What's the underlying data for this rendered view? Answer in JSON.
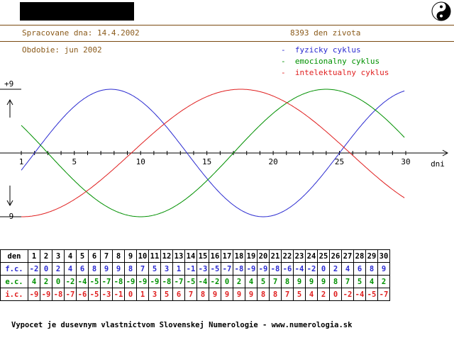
{
  "header": {
    "processed_label": "Spracovane dna: 14.4.2002",
    "days_lived": "8393 den zivota",
    "period_label": "Obdobie: jun 2002"
  },
  "colors": {
    "physical": "#2a2ad0",
    "emotional": "#009000",
    "intellectual": "#e02020",
    "header_text": "#8a5a1a"
  },
  "legend": [
    {
      "label": "-  fyzicky cyklus",
      "color": "#2a2ad0"
    },
    {
      "label": "-  emocionalny cyklus",
      "color": "#009000"
    },
    {
      "label": "-  intelektualny cyklus",
      "color": "#e02020"
    }
  ],
  "chart_data": {
    "type": "line",
    "xlabel": "dni",
    "ylim": [
      -9,
      9
    ],
    "y_ticks": [
      "+9",
      "-9"
    ],
    "x_ticks": [
      "1",
      "5",
      "10",
      "15",
      "20",
      "25",
      "30"
    ],
    "x": [
      1,
      2,
      3,
      4,
      5,
      6,
      7,
      8,
      9,
      10,
      11,
      12,
      13,
      14,
      15,
      16,
      17,
      18,
      19,
      20,
      21,
      22,
      23,
      24,
      25,
      26,
      27,
      28,
      29,
      30
    ],
    "series": [
      {
        "name": "fyzicky cyklus",
        "key": "physical",
        "phase": 23,
        "values": [
          -2,
          0,
          2,
          4,
          6,
          8,
          9,
          9,
          8,
          7,
          5,
          3,
          1,
          -1,
          -3,
          -5,
          -7,
          -8,
          -9,
          -9,
          -8,
          -6,
          -4,
          -2,
          0,
          2,
          4,
          6,
          8,
          9
        ]
      },
      {
        "name": "emocionalny cyklus",
        "key": "emotional",
        "phase": 28,
        "values": [
          4,
          2,
          0,
          -2,
          -4,
          -5,
          -7,
          -8,
          -9,
          -9,
          -9,
          -8,
          -7,
          -5,
          -4,
          -2,
          0,
          2,
          4,
          5,
          7,
          8,
          9,
          9,
          9,
          8,
          7,
          5,
          4,
          2
        ]
      },
      {
        "name": "intelektualny cyklus",
        "key": "intellectual",
        "phase": 33,
        "values": [
          -9,
          -9,
          -8,
          -7,
          -6,
          -5,
          -3,
          -1,
          0,
          1,
          3,
          5,
          6,
          7,
          8,
          9,
          9,
          9,
          9,
          8,
          8,
          7,
          5,
          4,
          2,
          0,
          -2,
          -4,
          -5,
          -7
        ]
      }
    ]
  },
  "table": {
    "rows": [
      {
        "label": "den",
        "values": [
          "1",
          "2",
          "3",
          "4",
          "5",
          "6",
          "7",
          "8",
          "9",
          "10",
          "11",
          "12",
          "13",
          "14",
          "15",
          "16",
          "17",
          "18",
          "19",
          "20",
          "21",
          "22",
          "23",
          "24",
          "25",
          "26",
          "27",
          "28",
          "29",
          "30"
        ]
      },
      {
        "label": "f.c.",
        "values": [
          "-2",
          "0",
          "2",
          "4",
          "6",
          "8",
          "9",
          "9",
          "8",
          "7",
          "5",
          "3",
          "1",
          "-1",
          "-3",
          "-5",
          "-7",
          "-8",
          "-9",
          "-9",
          "-8",
          "-6",
          "-4",
          "-2",
          "0",
          "2",
          "4",
          "6",
          "8",
          "9"
        ]
      },
      {
        "label": "e.c.",
        "values": [
          "4",
          "2",
          "0",
          "-2",
          "-4",
          "-5",
          "-7",
          "-8",
          "-9",
          "-9",
          "-9",
          "-8",
          "-7",
          "-5",
          "-4",
          "-2",
          "0",
          "2",
          "4",
          "5",
          "7",
          "8",
          "9",
          "9",
          "9",
          "8",
          "7",
          "5",
          "4",
          "2"
        ]
      },
      {
        "label": "i.c.",
        "values": [
          "-9",
          "-9",
          "-8",
          "-7",
          "-6",
          "-5",
          "-3",
          "-1",
          "0",
          "1",
          "3",
          "5",
          "6",
          "7",
          "8",
          "9",
          "9",
          "9",
          "9",
          "8",
          "8",
          "7",
          "5",
          "4",
          "2",
          "0",
          "-2",
          "-4",
          "-5",
          "-7"
        ]
      }
    ]
  },
  "footer": "Vypocet je dusevnym vlastnictvom Slovenskej Numerologie - www.numerologia.sk"
}
